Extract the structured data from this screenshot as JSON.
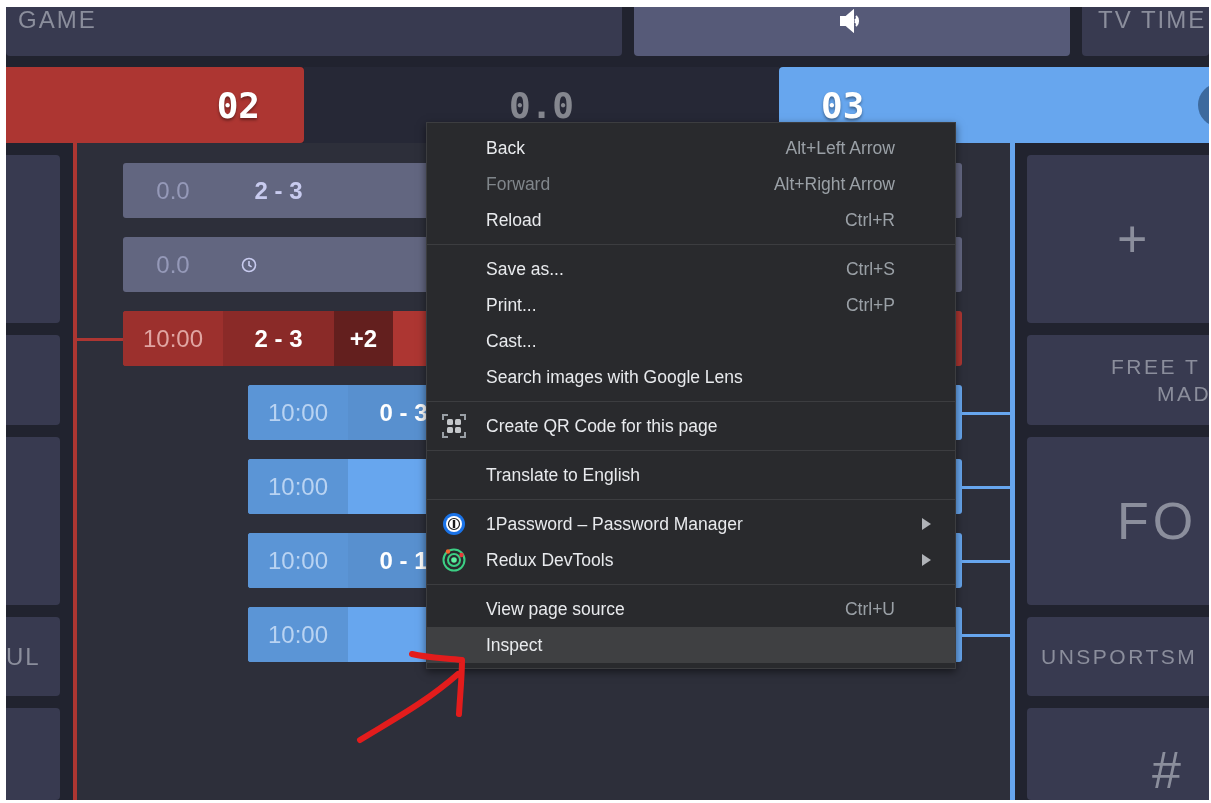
{
  "top_bar": {
    "game_label": "GAME",
    "timeout_label": "TV TIME"
  },
  "scoreboard": {
    "home_score": "02",
    "clock": "0.0",
    "away_score": "03"
  },
  "left_panel": {
    "foul_label": "UL"
  },
  "bracket": {
    "rows": [
      {
        "kind": "neutral",
        "time": "0.0",
        "score": "2 - 3"
      },
      {
        "kind": "scheduled",
        "time": "0.0"
      },
      {
        "kind": "home",
        "time": "10:00",
        "score": "2 - 3",
        "diff": "+2"
      },
      {
        "kind": "away",
        "time": "10:00",
        "score": "0 - 3"
      },
      {
        "kind": "away",
        "time": "10:00"
      },
      {
        "kind": "away",
        "time": "10:00",
        "score": "0 - 1"
      },
      {
        "kind": "away",
        "time": "10:00"
      }
    ]
  },
  "right_tiles": [
    {
      "kind": "big",
      "lines": [
        "+"
      ]
    },
    {
      "kind": "label",
      "lines": [
        "FREE T",
        "MAD"
      ]
    },
    {
      "kind": "big",
      "lines": [
        "FO"
      ]
    },
    {
      "kind": "label",
      "lines": [
        "UNSPORTSM"
      ]
    },
    {
      "kind": "big",
      "lines": [
        "#"
      ]
    }
  ],
  "context_menu": {
    "sections": [
      [
        {
          "kind": "plain",
          "label": "Back",
          "shortcut": "Alt+Left Arrow",
          "disabled": false,
          "highlighted": false,
          "submenu": false
        },
        {
          "kind": "plain",
          "label": "Forward",
          "shortcut": "Alt+Right Arrow",
          "disabled": true,
          "highlighted": false,
          "submenu": false
        },
        {
          "kind": "plain",
          "label": "Reload",
          "shortcut": "Ctrl+R",
          "disabled": false,
          "highlighted": false,
          "submenu": false
        }
      ],
      [
        {
          "kind": "plain",
          "label": "Save as...",
          "shortcut": "Ctrl+S",
          "disabled": false,
          "highlighted": false,
          "submenu": false
        },
        {
          "kind": "plain",
          "label": "Print...",
          "shortcut": "Ctrl+P",
          "disabled": false,
          "highlighted": false,
          "submenu": false
        },
        {
          "kind": "plain",
          "label": "Cast...",
          "disabled": false,
          "highlighted": false,
          "submenu": false
        },
        {
          "kind": "plain",
          "label": "Search images with Google Lens",
          "disabled": false,
          "highlighted": false,
          "submenu": false
        }
      ],
      [
        {
          "kind": "qr",
          "label": "Create QR Code for this page",
          "disabled": false,
          "highlighted": false,
          "submenu": false
        }
      ],
      [
        {
          "kind": "plain",
          "label": "Translate to English",
          "disabled": false,
          "highlighted": false,
          "submenu": false
        }
      ],
      [
        {
          "kind": "password",
          "label": "1Password – Password Manager",
          "disabled": false,
          "highlighted": false,
          "submenu": true
        },
        {
          "kind": "devtools",
          "label": "Redux DevTools",
          "disabled": false,
          "highlighted": false,
          "submenu": true
        }
      ],
      [
        {
          "kind": "plain",
          "label": "View page source",
          "shortcut": "Ctrl+U",
          "disabled": false,
          "highlighted": false,
          "submenu": false
        },
        {
          "kind": "plain",
          "label": "Inspect",
          "disabled": false,
          "highlighted": true,
          "submenu": false
        }
      ]
    ]
  }
}
